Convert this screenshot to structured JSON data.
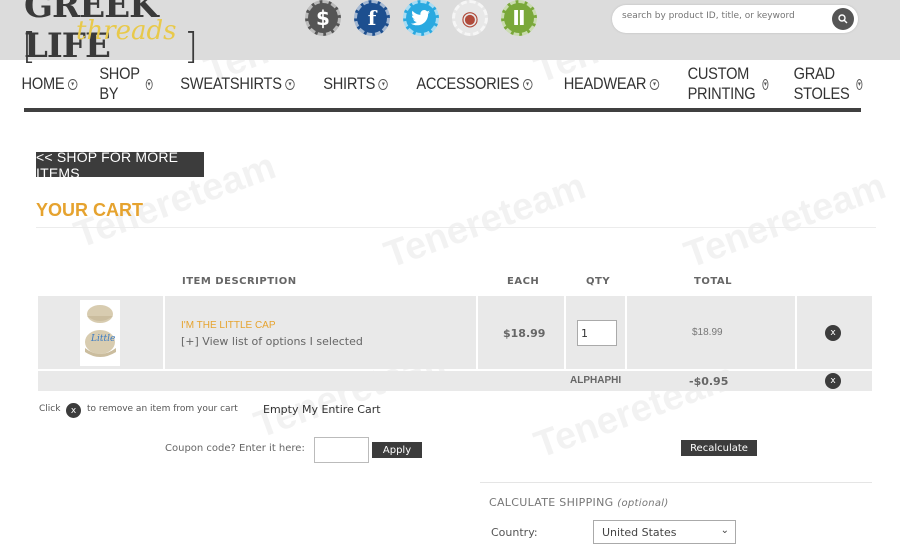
{
  "logo": {
    "line1": "GREEK LIFE",
    "line2": "threads"
  },
  "social_icons": [
    {
      "name": "dollar-icon",
      "glyph": "$",
      "color": "#555555"
    },
    {
      "name": "facebook-icon",
      "glyph": "f",
      "color": "#1d4f8f"
    },
    {
      "name": "twitter-icon",
      "glyph": "t",
      "color": "#2aa9e0"
    },
    {
      "name": "instagram-icon",
      "glyph": "◉",
      "color": "#e8e8e8"
    },
    {
      "name": "greek-letters-icon",
      "glyph": "Ⅱ",
      "color": "#7aa83a"
    }
  ],
  "search": {
    "placeholder": "search by product ID, title, or keyword",
    "icon": "search-icon"
  },
  "nav": {
    "items": [
      {
        "label": "HOME"
      },
      {
        "label": "SHOP BY"
      },
      {
        "label": "SWEATSHIRTS"
      },
      {
        "label": "SHIRTS"
      },
      {
        "label": "ACCESSORIES"
      },
      {
        "label": "HEADWEAR"
      },
      {
        "label": "CUSTOM PRINTING"
      },
      {
        "label": "GRAD STOLES"
      }
    ]
  },
  "shop_more_label": "<< SHOP FOR MORE ITEMS",
  "cart": {
    "title": "YOUR CART",
    "headers": {
      "description": "ITEM  DESCRIPTION",
      "each": "EACH",
      "qty": "QTY",
      "total": "TOTAL"
    },
    "item": {
      "name": "I'M THE LITTLE CAP",
      "options_link": "[+] View list of options I selected",
      "each": "$18.99",
      "qty": "1",
      "total": "$18.99",
      "cap_text": "Little"
    },
    "discount": {
      "label": "ALPHAPHI",
      "amount": "-$0.95"
    },
    "remove_hint_pre": "Click",
    "remove_hint_post": "to remove an item from your cart",
    "empty_cart": "Empty My Entire Cart",
    "remove_glyph": "x"
  },
  "coupon": {
    "label": "Coupon code? Enter it here:",
    "apply": "Apply"
  },
  "recalculate": "Recalculate",
  "shipping": {
    "title": "CALCULATE SHIPPING",
    "optional": "(optional)",
    "country_label": "Country:",
    "country_value": "United States"
  },
  "watermark": "Tenereteam",
  "colors": {
    "accent": "#e6a32f",
    "dark": "#3c3c3c"
  }
}
